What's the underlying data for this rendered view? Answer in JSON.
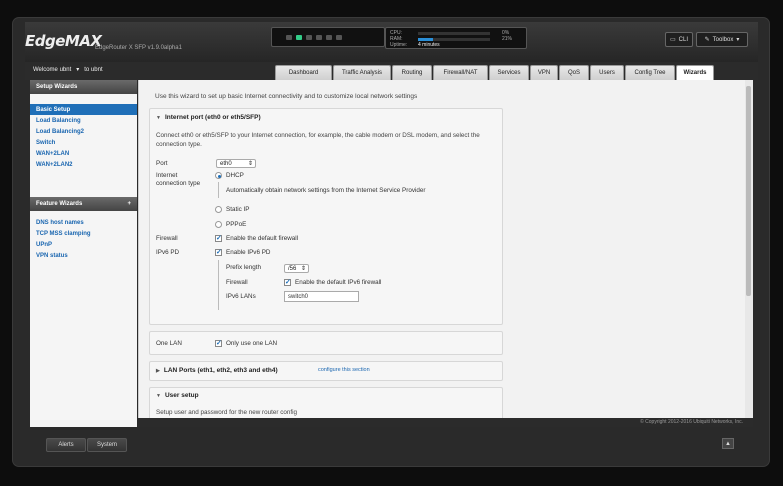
{
  "header": {
    "logo": "EdgeMAX",
    "subtitle": "EdgeRouter X SFP v1.9.0alpha1",
    "stats": {
      "cpu_label": "CPU:",
      "cpu_value": "0%",
      "cpu_fraction": 0.0,
      "ram_label": "RAM:",
      "ram_value": "21%",
      "ram_fraction": 0.21,
      "uptime_label": "Uptime:",
      "uptime_value": "4 minutes"
    },
    "cli_label": "CLI",
    "toolbox_label": "Toolbox"
  },
  "nav": {
    "welcome": "Welcome ubnt",
    "to": "to ubnt",
    "tabs": [
      "Dashboard",
      "Traffic Analysis",
      "Routing",
      "Firewall/NAT",
      "Services",
      "VPN",
      "QoS",
      "Users",
      "Config Tree",
      "Wizards"
    ]
  },
  "sidebar": {
    "setup_title": "Setup Wizards",
    "setup_items": [
      "Basic Setup",
      "Load Balancing",
      "Load Balancing2",
      "Switch",
      "WAN+2LAN",
      "WAN+2LAN2"
    ],
    "feature_title": "Feature Wizards",
    "feature_add": "+",
    "feature_items": [
      "DNS host names",
      "TCP MSS clamping",
      "UPnP",
      "VPN status"
    ]
  },
  "main": {
    "intro": "Use this wizard to set up basic Internet connectivity and to customize local network settings",
    "internet": {
      "title": "Internet port (eth0 or eth5/SFP)",
      "desc": "Connect eth0 or eth5/SFP to your Internet connection, for example, the cable modem or DSL modem, and select the connection type.",
      "port_label": "Port",
      "port_value": "eth0",
      "conn_label": "Internet connection type",
      "dhcp": "DHCP",
      "dhcp_desc": "Automatically obtain network settings from the Internet Service Provider",
      "static": "Static IP",
      "pppoe": "PPPoE",
      "firewall_label": "Firewall",
      "firewall_check": "Enable the default firewall",
      "ipv6_label": "IPv6 PD",
      "ipv6_check": "Enable IPv6 PD",
      "prefix_label": "Prefix length",
      "prefix_value": "/56",
      "fw6_label": "Firewall",
      "fw6_check": "Enable the default IPv6 firewall",
      "lans_label": "IPv6 LANs",
      "lans_value": "switch0"
    },
    "one_lan": {
      "label": "One LAN",
      "check": "Only use one LAN"
    },
    "lan_ports": {
      "title": "LAN Ports (eth1, eth2, eth3 and eth4)",
      "link": "configure this section"
    },
    "user_setup": {
      "title": "User setup",
      "desc": "Setup user and password for the new router config"
    }
  },
  "footer": {
    "copyright": "© Copyright 2012-2016 Ubiquiti Networks, Inc.",
    "alerts": "Alerts",
    "system": "System"
  }
}
